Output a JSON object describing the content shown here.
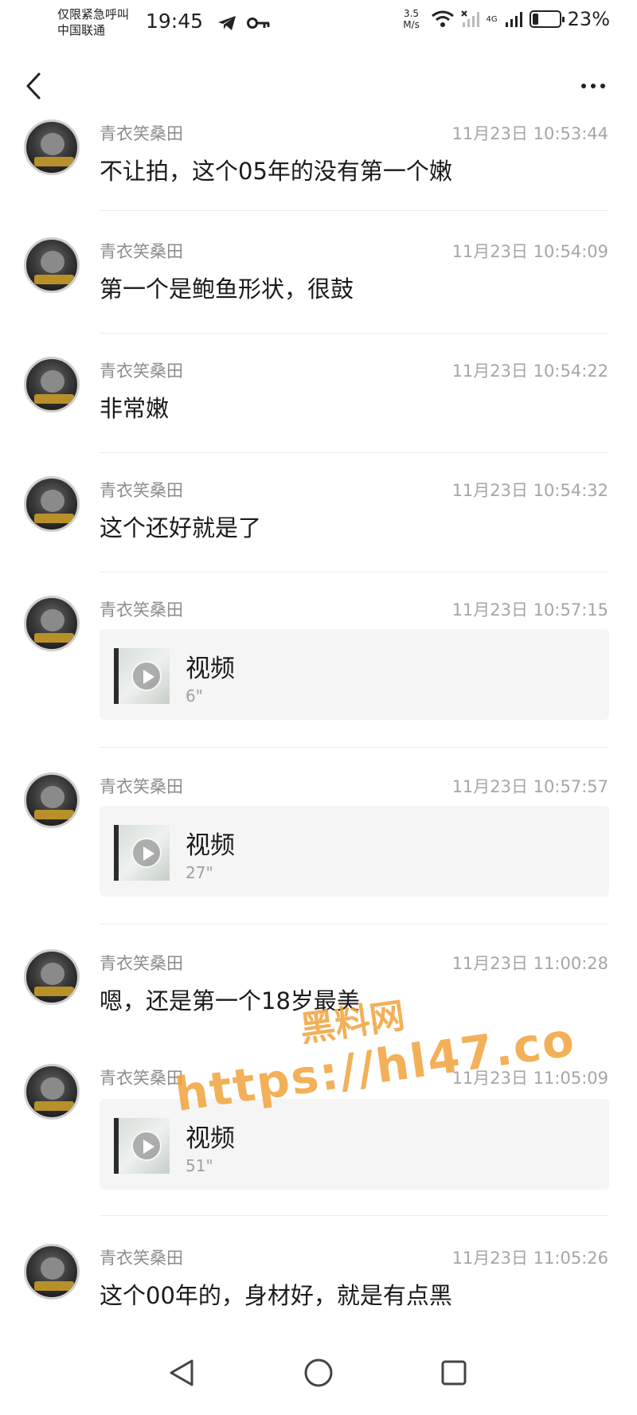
{
  "status_bar": {
    "carrier_line1": "仅限紧急呼叫",
    "carrier_line2": "中国联通",
    "time": "19:45",
    "speed_value": "3.5",
    "speed_unit": "M/s",
    "signal_label": "4G",
    "battery_level": 0.23,
    "battery_percent": "23%"
  },
  "header": {
    "back_icon": "chevron-left-icon",
    "more_icon": "more-horizontal-icon"
  },
  "messages": [
    {
      "sender": "青衣笑桑田",
      "time": "11月23日 10:53:44",
      "type": "text",
      "text": "不让拍，这个05年的没有第一个嫩"
    },
    {
      "sender": "青衣笑桑田",
      "time": "11月23日 10:54:09",
      "type": "text",
      "text": "第一个是鲍鱼形状，很鼓"
    },
    {
      "sender": "青衣笑桑田",
      "time": "11月23日 10:54:22",
      "type": "text",
      "text": "非常嫩"
    },
    {
      "sender": "青衣笑桑田",
      "time": "11月23日 10:54:32",
      "type": "text",
      "text": "这个还好就是了"
    },
    {
      "sender": "青衣笑桑田",
      "time": "11月23日 10:57:15",
      "type": "video",
      "title": "视频",
      "duration": "6\""
    },
    {
      "sender": "青衣笑桑田",
      "time": "11月23日 10:57:57",
      "type": "video",
      "title": "视频",
      "duration": "27\""
    },
    {
      "sender": "青衣笑桑田",
      "time": "11月23日 11:00:28",
      "type": "text",
      "text": "嗯，还是第一个18岁最美"
    },
    {
      "sender": "青衣笑桑田",
      "time": "11月23日 11:05:09",
      "type": "video",
      "title": "视频",
      "duration": "51\""
    },
    {
      "sender": "青衣笑桑田",
      "time": "11月23日 11:05:26",
      "type": "text",
      "text": "这个00年的，身材好，就是有点黑"
    }
  ],
  "watermark": {
    "line1": "黑料网",
    "line2": "https://hl47.co",
    "color": "#f2a33c"
  },
  "nav_bar": {
    "back_icon": "triangle-back-icon",
    "home_icon": "circle-home-icon",
    "recents_icon": "square-recents-icon"
  }
}
